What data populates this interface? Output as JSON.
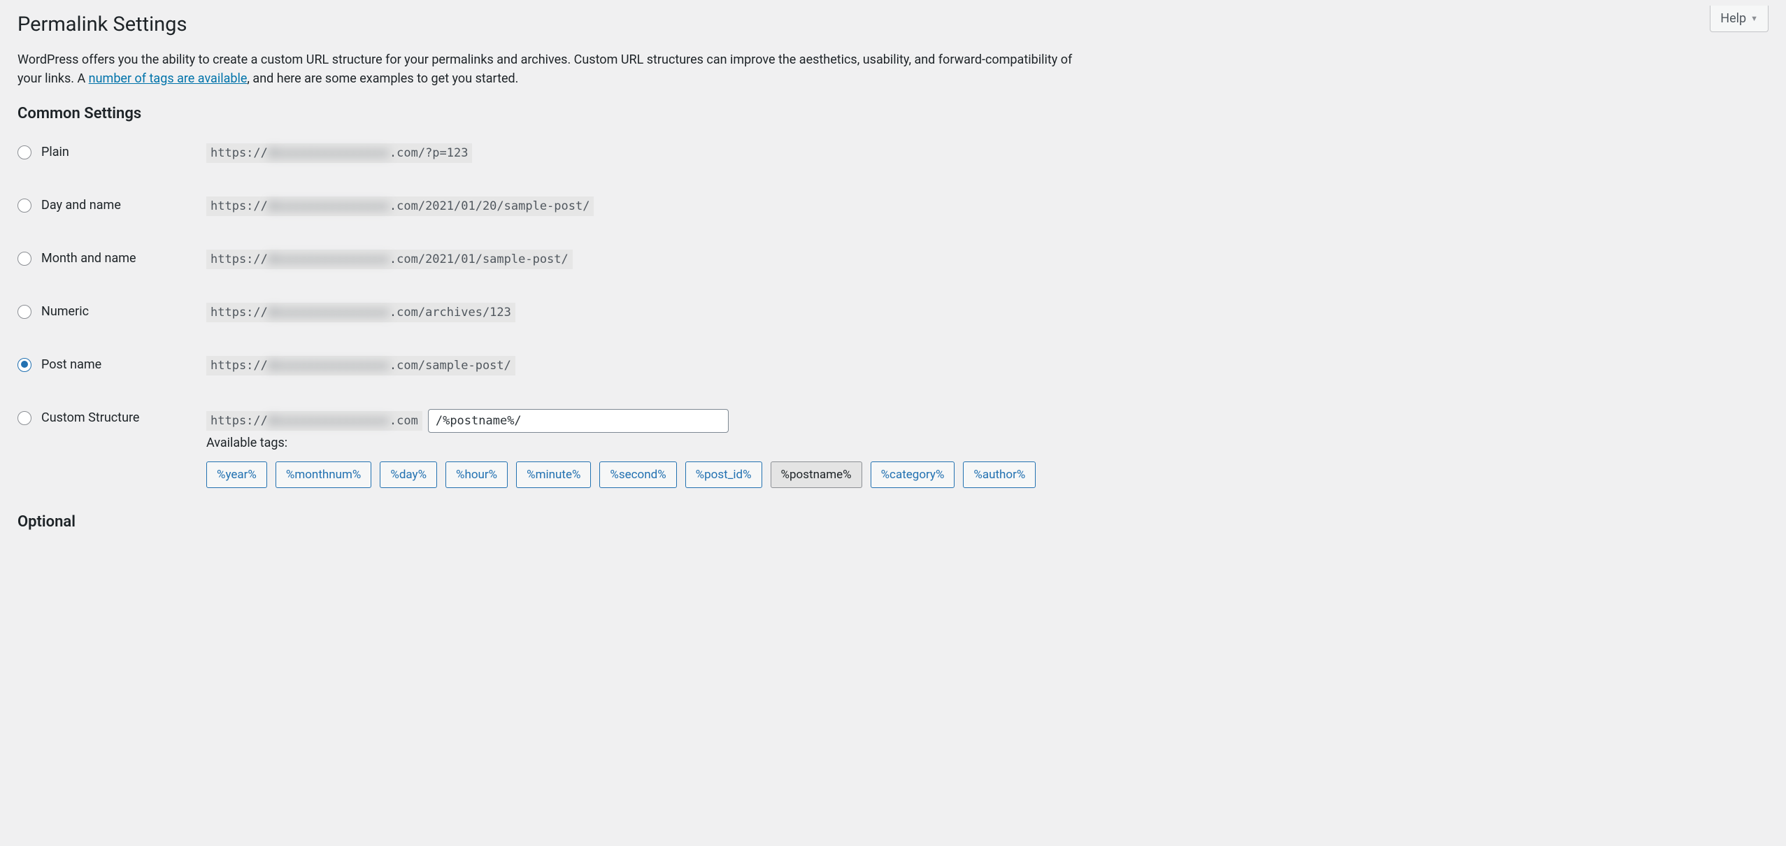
{
  "help_label": "Help",
  "page_title": "Permalink Settings",
  "intro_pre": "WordPress offers you the ability to create a custom URL structure for your permalinks and archives. Custom URL structures can improve the aesthetics, usability, and forward-compatibility of your links. A ",
  "intro_link": "number of tags are available",
  "intro_post": ", and here are some examples to get you started.",
  "section_common": "Common Settings",
  "url_prefix": "https://",
  "url_blur": "dxxxxxxxxxxxxxxxx",
  "options": {
    "plain": {
      "label": "Plain",
      "suffix": ".com/?p=123"
    },
    "dayname": {
      "label": "Day and name",
      "suffix": ".com/2021/01/20/sample-post/"
    },
    "monname": {
      "label": "Month and name",
      "suffix": ".com/2021/01/sample-post/"
    },
    "numeric": {
      "label": "Numeric",
      "suffix": ".com/archives/123"
    },
    "postname": {
      "label": "Post name",
      "suffix": ".com/sample-post/"
    },
    "custom": {
      "label": "Custom Structure",
      "suffix": ".com"
    }
  },
  "selected": "postname",
  "custom_value": "/%postname%/",
  "available_tags_label": "Available tags:",
  "tags": [
    "%year%",
    "%monthnum%",
    "%day%",
    "%hour%",
    "%minute%",
    "%second%",
    "%post_id%",
    "%postname%",
    "%category%",
    "%author%"
  ],
  "active_tag": "%postname%",
  "section_optional": "Optional"
}
